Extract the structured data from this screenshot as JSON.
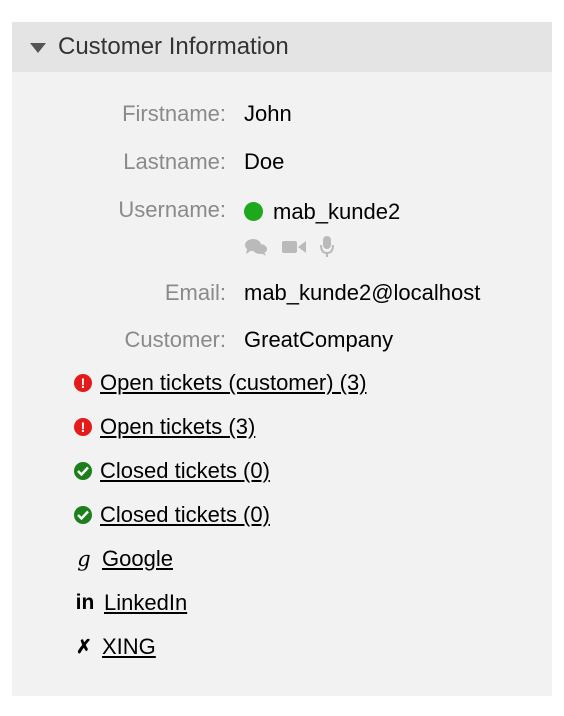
{
  "header": {
    "title": "Customer Information"
  },
  "fields": {
    "firstname": {
      "label": "Firstname:",
      "value": "John"
    },
    "lastname": {
      "label": "Lastname:",
      "value": "Doe"
    },
    "username": {
      "label": "Username:",
      "value": "mab_kunde2",
      "status_color": "#1ea81e"
    },
    "email": {
      "label": "Email:",
      "value": "mab_kunde2@localhost"
    },
    "customer": {
      "label": "Customer:",
      "value": "GreatCompany"
    }
  },
  "comm_icons": [
    "chat-icon",
    "video-icon",
    "microphone-icon"
  ],
  "links": [
    {
      "text": "Open tickets (customer) (3)",
      "icon": "error-icon",
      "color": "#e31b1b"
    },
    {
      "text": "Open tickets (3)",
      "icon": "error-icon",
      "color": "#e31b1b"
    },
    {
      "text": "Closed tickets (0)",
      "icon": "check-icon",
      "color": "#1c7f1c"
    },
    {
      "text": "Closed tickets (0)",
      "icon": "check-icon",
      "color": "#1c7f1c"
    },
    {
      "text": "Google",
      "icon": "google-icon",
      "glyph": "g"
    },
    {
      "text": "LinkedIn",
      "icon": "linkedin-icon",
      "glyph": "in"
    },
    {
      "text": "XING",
      "icon": "xing-icon",
      "glyph": "✗"
    }
  ]
}
